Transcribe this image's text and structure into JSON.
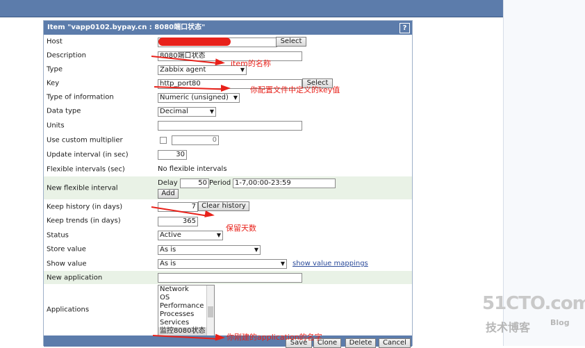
{
  "window": {
    "title": "Item \"vapp0102.bypay.cn : 8080端口状态\""
  },
  "form": {
    "host": {
      "label": "Host",
      "value": "",
      "select_label": "Select"
    },
    "description": {
      "label": "Description",
      "value": "8080端口状态"
    },
    "type": {
      "label": "Type",
      "value": "Zabbix agent"
    },
    "key": {
      "label": "Key",
      "value": "http_port80",
      "select_label": "Select"
    },
    "type_of_information": {
      "label": "Type of information",
      "value": "Numeric (unsigned)"
    },
    "data_type": {
      "label": "Data type",
      "value": "Decimal"
    },
    "units": {
      "label": "Units",
      "value": ""
    },
    "custom_multiplier": {
      "label": "Use custom multiplier",
      "value": "0"
    },
    "update_interval": {
      "label": "Update interval (in sec)",
      "value": "30"
    },
    "flexible_intervals": {
      "label": "Flexible intervals (sec)",
      "value": "No flexible intervals"
    },
    "new_flexible_interval": {
      "label": "New flexible interval",
      "delay_label": "Delay",
      "delay_value": "50",
      "period_label": "Period",
      "period_value": "1-7,00:00-23:59",
      "add_label": "Add"
    },
    "keep_history": {
      "label": "Keep history (in days)",
      "value": "7",
      "clear_label": "Clear history"
    },
    "keep_trends": {
      "label": "Keep trends (in days)",
      "value": "365"
    },
    "status": {
      "label": "Status",
      "value": "Active"
    },
    "store_value": {
      "label": "Store value",
      "value": "As is"
    },
    "show_value": {
      "label": "Show value",
      "value": "As is",
      "mappings_link": "show value mappings"
    },
    "new_application": {
      "label": "New application",
      "value": ""
    },
    "applications": {
      "label": "Applications",
      "options": [
        "Network",
        "OS",
        "Performance",
        "Processes",
        "Services",
        "监控8080状态"
      ]
    }
  },
  "footer": {
    "save": "Save",
    "clone": "Clone",
    "delete": "Delete",
    "cancel": "Cancel"
  },
  "annotations": {
    "description_note": "item的名称",
    "key_note": "你配置文件中定义的key值",
    "history_note": "保留天数",
    "application_note": "你刚建的application的名字"
  },
  "watermark": {
    "brand": "51CTO.com",
    "sub": "技术博客",
    "blog": "Blog"
  },
  "colors": {
    "header_blue": "#5c7cab",
    "alt_row": "#e9f2e6",
    "annotation_red": "#e8211a"
  }
}
